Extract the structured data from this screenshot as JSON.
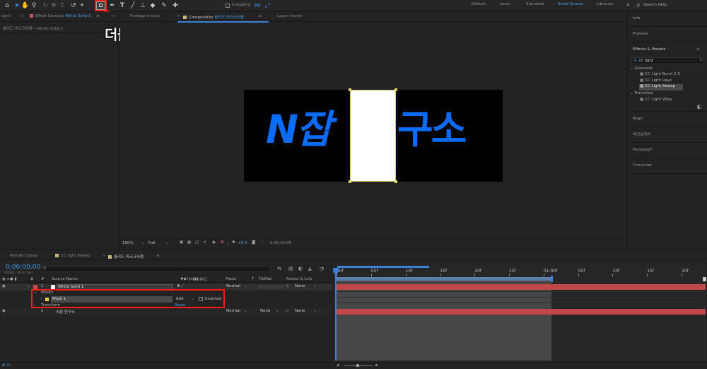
{
  "annotation": {
    "text": "더블클릭",
    "color": "#ff1a1a"
  },
  "toolbar": {
    "snapping_label": "Snapping",
    "workspaces": [
      "Default",
      "Learn",
      "Standard",
      "Small Screen",
      "Libraries"
    ],
    "active_workspace": "Small Screen",
    "more": "»",
    "search_placeholder": "Search Help"
  },
  "project_tab": "oject",
  "effect_controls": {
    "tab_label": "Effect Controls",
    "tab_layer": "White Solid 1",
    "breadcrumb": "솔리드 마스크사용 • White Solid 1"
  },
  "footage_tab": "Footage (none)",
  "composition_tab": {
    "prefix": "Composition",
    "name": "솔리드 마스크사용"
  },
  "layer_tab": "Layer (none)",
  "viewer": {
    "left_text": "N잡",
    "right_text": "구소",
    "text_color": "#0a6cff",
    "zoom": "100%",
    "resolution": "Full",
    "exposure": "+0.0",
    "timecode": "0;00;00;00"
  },
  "right_panels": {
    "info": "Info",
    "preview": "Preview",
    "effects_presets": "Effects & Presets",
    "search_value": "cc light",
    "groups": [
      {
        "name": "Generate",
        "items": [
          "CC Light Burst 2.5",
          "CC Light Rays",
          "CC Light Sweep"
        ]
      },
      {
        "name": "Transition",
        "items": [
          "CC Light Wipe"
        ]
      }
    ],
    "selected_item": "CC Light Sweep",
    "align": "Align",
    "library": "라이브러리",
    "paragraph": "Paragraph",
    "character": "Character"
  },
  "timeline": {
    "tabs": [
      "Render Queue",
      "CC light Sweep",
      "솔리드 마스크사용"
    ],
    "current_time": "0;00;00;00",
    "frame_info": "00000 (29.97 fps)",
    "columns": [
      "Source Name",
      "Mode",
      "T",
      "TrkMat",
      "Parent & Link"
    ],
    "layers": [
      {
        "num": "1",
        "name": "White Solid 1",
        "mode": "Normal",
        "trkmat": "",
        "parent": "None"
      },
      {
        "num": "2",
        "name": "N잡 연구소",
        "mode": "Normal",
        "trkmat": "None",
        "parent": "None"
      }
    ],
    "masks_label": "Masks",
    "mask_name": "Mask 1",
    "mask_mode": "Add",
    "inverted_label": "Inverted",
    "transform_label": "Transform",
    "reset_label": "Reset",
    "ruler": [
      "00f",
      "05f",
      "10f",
      "15f",
      "20f",
      "25f",
      "01:00f",
      "05f",
      "10f",
      "15f",
      "20f"
    ]
  }
}
